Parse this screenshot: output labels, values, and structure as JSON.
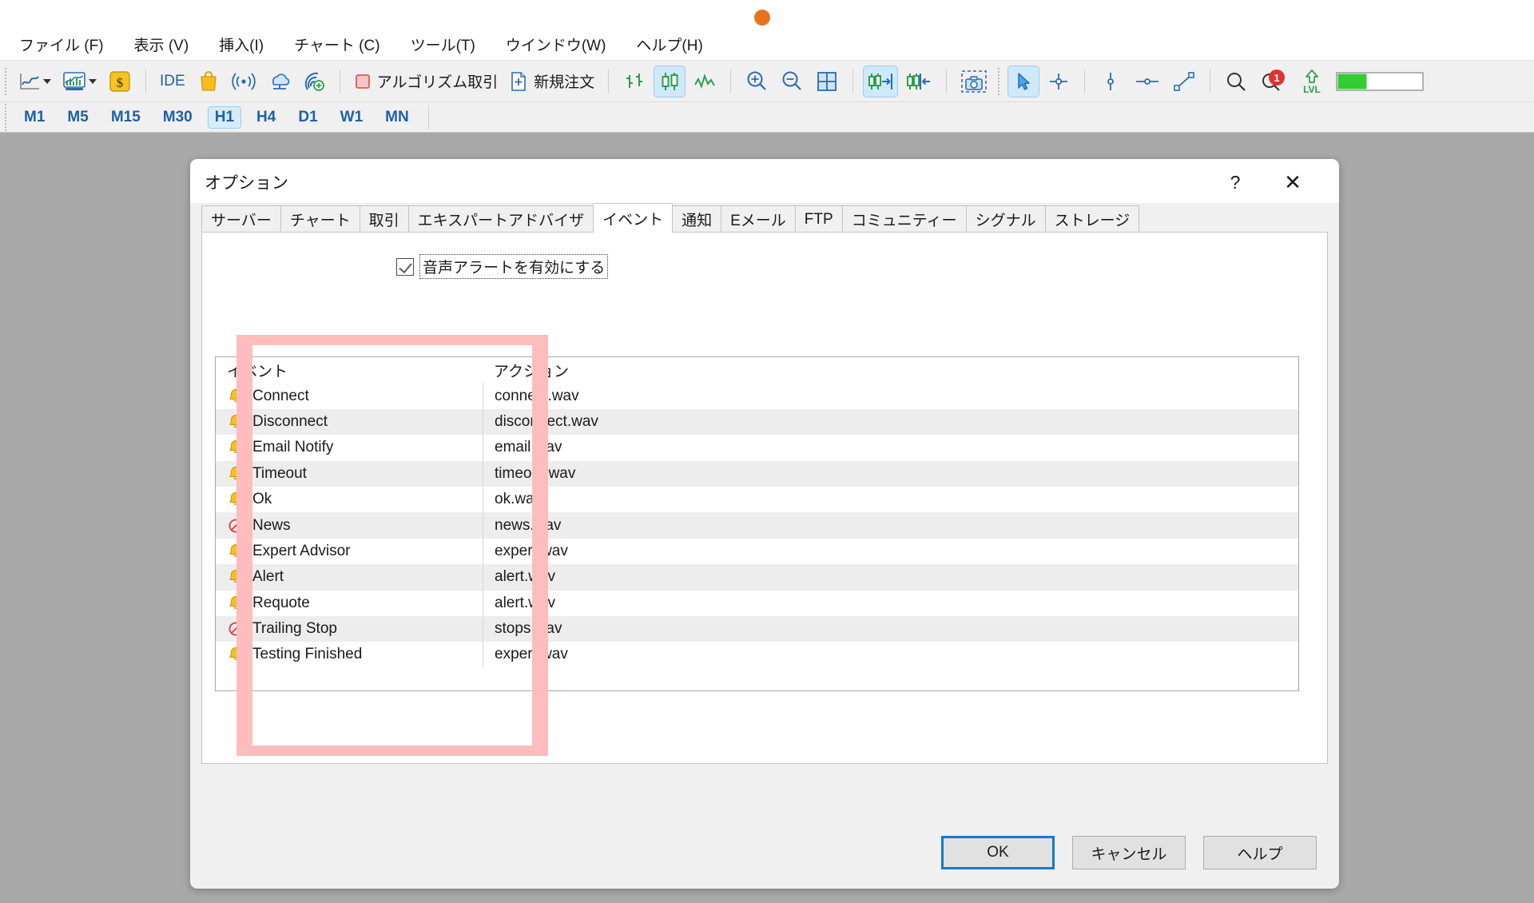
{
  "window": {
    "dot_color": "#e8731f"
  },
  "menubar": {
    "items": [
      {
        "label": "ファイル (F)",
        "name": "menu-file"
      },
      {
        "label": "表示 (V)",
        "name": "menu-view"
      },
      {
        "label": "挿入(I)",
        "name": "menu-insert"
      },
      {
        "label": "チャート (C)",
        "name": "menu-chart"
      },
      {
        "label": "ツール(T)",
        "name": "menu-tools"
      },
      {
        "label": "ウインドウ(W)",
        "name": "menu-window"
      },
      {
        "label": "ヘルプ(H)",
        "name": "menu-help"
      }
    ]
  },
  "toolbar": {
    "ide_label": "IDE",
    "algo_label": "アルゴリズム取引",
    "neworder_label": "新規注文",
    "lvl_label": "LVL",
    "badge_count": "1"
  },
  "periods": {
    "items": [
      "M1",
      "M5",
      "M15",
      "M30",
      "H1",
      "H4",
      "D1",
      "W1",
      "MN"
    ],
    "selected": "H1"
  },
  "dialog": {
    "title": "オプション",
    "help_glyph": "?",
    "close_glyph": "✕",
    "tabs": [
      "サーバー",
      "チャート",
      "取引",
      "エキスパートアドバイザ",
      "イベント",
      "通知",
      "Eメール",
      "FTP",
      "コミュニティー",
      "シグナル",
      "ストレージ"
    ],
    "selected_tab": "イベント",
    "enable_sound_label": "音声アラートを有効にする",
    "enable_sound_checked": true,
    "table": {
      "headers": [
        "イベント",
        "アクション"
      ],
      "rows": [
        {
          "icon": "bell-icon",
          "event": "Connect",
          "action": "connect.wav"
        },
        {
          "icon": "bell-icon",
          "event": "Disconnect",
          "action": "disconnect.wav"
        },
        {
          "icon": "bell-icon",
          "event": "Email Notify",
          "action": "email.wav"
        },
        {
          "icon": "bell-icon",
          "event": "Timeout",
          "action": "timeout.wav"
        },
        {
          "icon": "bell-icon",
          "event": "Ok",
          "action": "ok.wav"
        },
        {
          "icon": "block-icon",
          "event": "News",
          "action": "news.wav"
        },
        {
          "icon": "bell-icon",
          "event": "Expert Advisor",
          "action": "expert.wav"
        },
        {
          "icon": "bell-icon",
          "event": "Alert",
          "action": "alert.wav"
        },
        {
          "icon": "bell-icon",
          "event": "Requote",
          "action": "alert.wav"
        },
        {
          "icon": "block-icon",
          "event": "Trailing Stop",
          "action": "stops.wav"
        },
        {
          "icon": "bell-icon",
          "event": "Testing Finished",
          "action": "expert.wav"
        }
      ]
    },
    "buttons": {
      "ok": "OK",
      "cancel": "キャンセル",
      "help": "ヘルプ"
    }
  },
  "colors": {
    "accent": "#0a7bd6",
    "highlight": "#febcbc",
    "bell": "#f5c026",
    "block": "#e23b3b",
    "tab_text": "#1a1a1a",
    "period_text": "#2060a8"
  }
}
